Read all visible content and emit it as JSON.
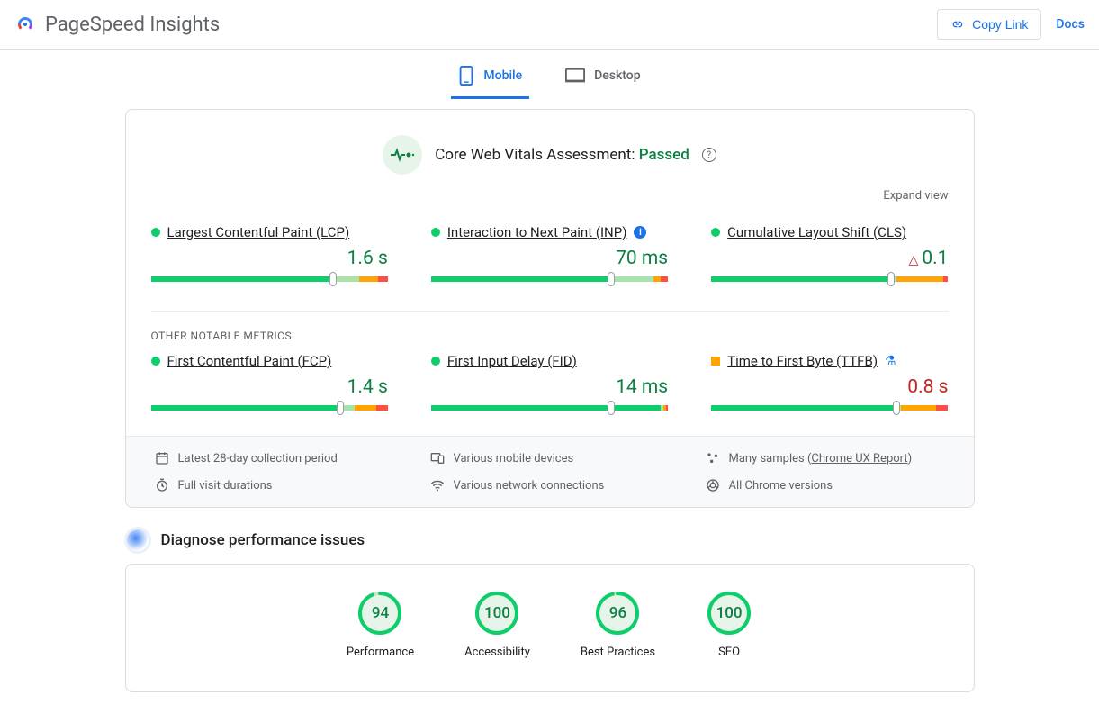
{
  "header": {
    "title": "PageSpeed Insights",
    "copy_link": "Copy Link",
    "docs": "Docs"
  },
  "tabs": {
    "mobile": "Mobile",
    "desktop": "Desktop"
  },
  "cwv": {
    "title_prefix": "Core Web Vitals Assessment: ",
    "status": "Passed",
    "expand": "Expand view"
  },
  "metrics": [
    {
      "name": "Largest Contentful Paint (LCP)",
      "value": "1.6 s",
      "status": "good",
      "info": false,
      "handle": 77,
      "segs": [
        77,
        11,
        8,
        4
      ]
    },
    {
      "name": "Interaction to Next Paint (INP)",
      "value": "70 ms",
      "status": "good",
      "info": true,
      "handle": 76,
      "segs": [
        76,
        18,
        3,
        3
      ]
    },
    {
      "name": "Cumulative Layout Shift (CLS)",
      "value": "0.1",
      "status": "good",
      "info": false,
      "warn": true,
      "handle": 76,
      "segs": [
        76,
        2,
        20,
        2
      ]
    },
    {
      "name": "First Contentful Paint (FCP)",
      "value": "1.4 s",
      "status": "good",
      "info": false,
      "handle": 80,
      "segs": [
        80,
        6,
        9,
        5
      ]
    },
    {
      "name": "First Input Delay (FID)",
      "value": "14 ms",
      "status": "good",
      "info": false,
      "handle": 76,
      "segs": [
        97,
        1,
        1,
        1
      ]
    },
    {
      "name": "Time to First Byte (TTFB)",
      "value": "0.8 s",
      "status": "ni",
      "info": false,
      "flask": true,
      "handle": 78,
      "segs": [
        78,
        2,
        15,
        5
      ],
      "value_color": "orange"
    }
  ],
  "other_label": "OTHER NOTABLE METRICS",
  "footer": {
    "period": "Latest 28-day collection period",
    "devices": "Various mobile devices",
    "samples_prefix": "Many samples (",
    "samples_link": "Chrome UX Report",
    "samples_suffix": ")",
    "durations": "Full visit durations",
    "network": "Various network connections",
    "versions": "All Chrome versions"
  },
  "diagnose": {
    "title": "Diagnose performance issues"
  },
  "scores": [
    {
      "label": "Performance",
      "value": "94",
      "pct": 94
    },
    {
      "label": "Accessibility",
      "value": "100",
      "pct": 100
    },
    {
      "label": "Best Practices",
      "value": "96",
      "pct": 96
    },
    {
      "label": "SEO",
      "value": "100",
      "pct": 100
    }
  ],
  "colors": {
    "green": "#0cce6b",
    "lightgreen": "#a9e3a9",
    "orange": "#ffa400",
    "red": "#ff4e42"
  }
}
